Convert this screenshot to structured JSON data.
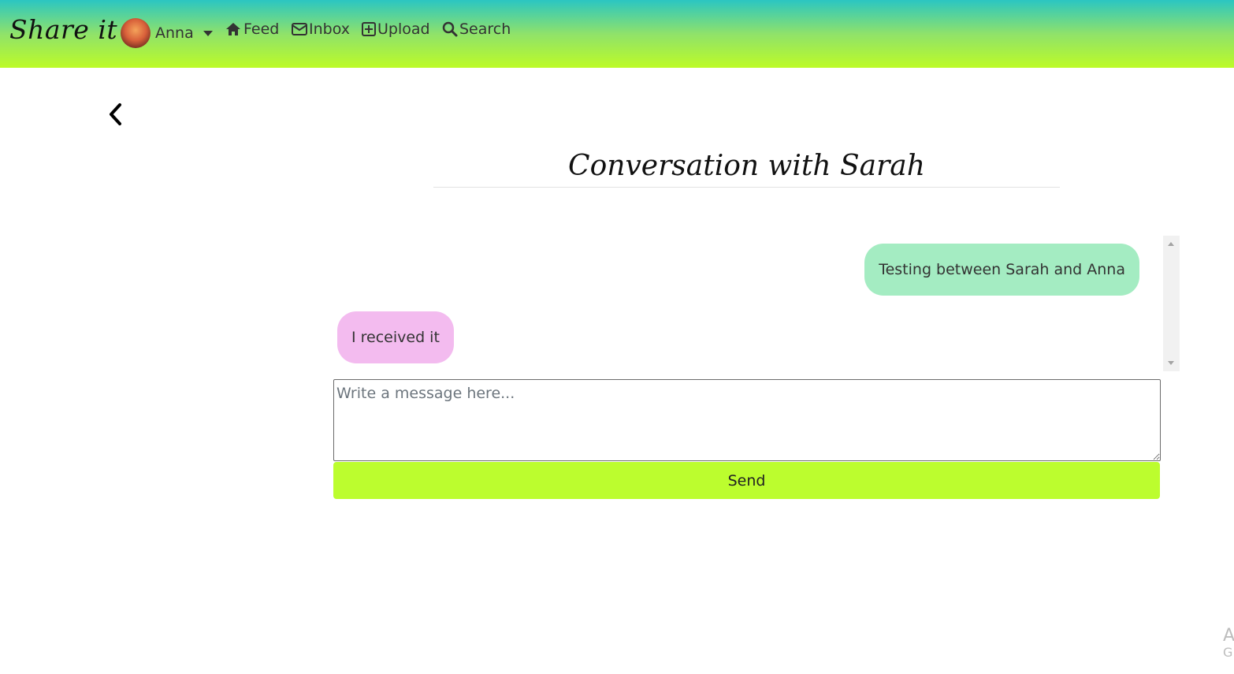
{
  "navbar": {
    "brand": "Share it",
    "user": {
      "name": "Anna"
    },
    "links": [
      {
        "label": "Feed",
        "icon": "home-icon"
      },
      {
        "label": "Inbox",
        "icon": "envelope-icon"
      },
      {
        "label": "Upload",
        "icon": "plus-square-icon"
      },
      {
        "label": "Search",
        "icon": "search-icon"
      }
    ]
  },
  "page": {
    "title": "Conversation with Sarah",
    "back_icon": "chevron-left-icon"
  },
  "messages": [
    {
      "text": "Testing between Sarah and Anna",
      "direction": "sent",
      "color": "#a4ecc2"
    },
    {
      "text": "I received it",
      "direction": "received",
      "color": "#f3bbef"
    }
  ],
  "composer": {
    "placeholder": "Write a message here...",
    "value": "",
    "send_label": "Send"
  },
  "corner": {
    "line1": "A",
    "line2": "G"
  },
  "colors": {
    "accent": "#bcfd2e",
    "navbar_top": "#2bc6c2"
  }
}
